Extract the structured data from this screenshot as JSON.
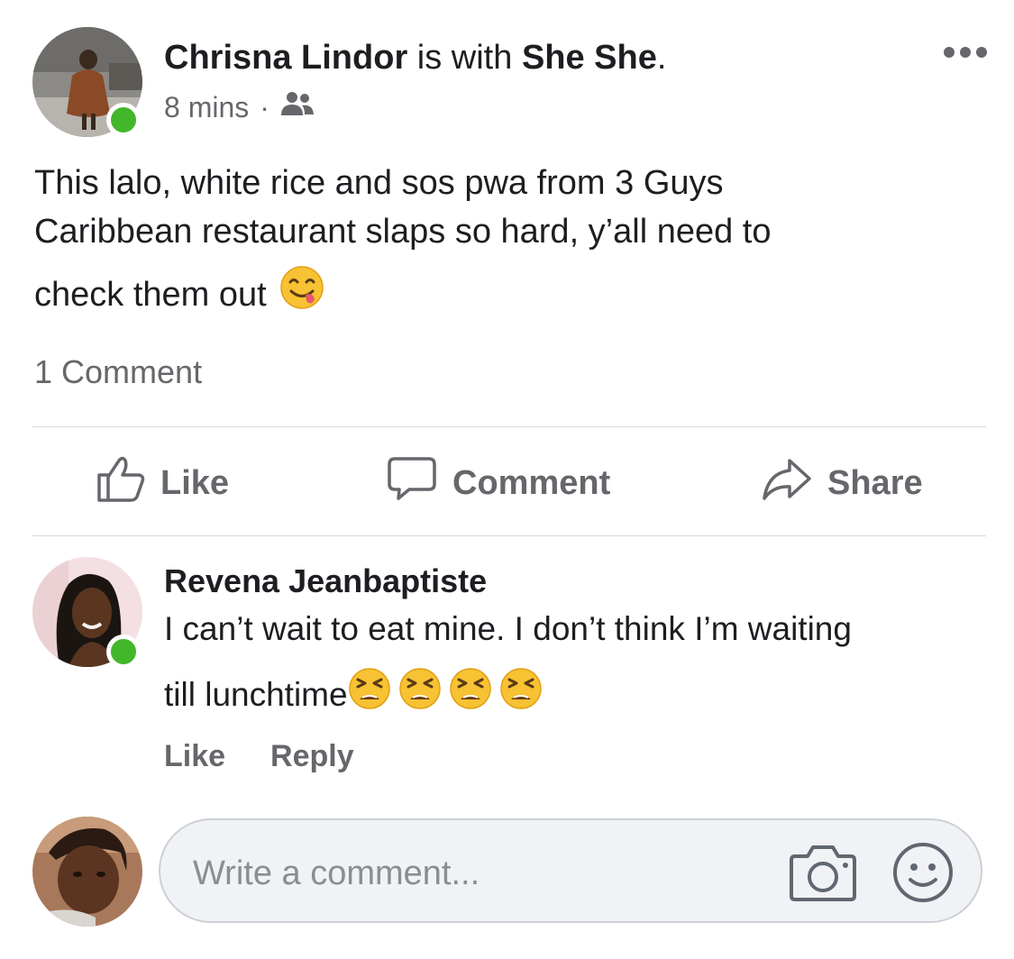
{
  "post": {
    "author": "Chrisna Lindor",
    "with_text": " is with ",
    "tagged": "She She",
    "period": ".",
    "time": "8 mins",
    "separator": "·",
    "audience_icon": "friends-icon",
    "text_line1": "This lalo, white rice and sos pwa from 3 Guys",
    "text_line2": "Caribbean restaurant slaps so hard, y’all need to",
    "text_line3": "check them out",
    "emoji": "yum-face-emoji",
    "comment_count": "1 Comment"
  },
  "actions": {
    "like": "Like",
    "comment": "Comment",
    "share": "Share"
  },
  "comment": {
    "author": "Revena Jeanbaptiste",
    "text_line1": "I can’t wait to eat mine. I don’t think I’m waiting",
    "text_line2": "till lunchtime",
    "emoji": "tired-face-emoji",
    "emoji_count": 4,
    "like": "Like",
    "reply": "Reply"
  },
  "composer": {
    "placeholder": "Write a comment..."
  },
  "colors": {
    "online": "#42b72a",
    "secondary_text": "#65676b",
    "divider": "#d5d7da"
  }
}
